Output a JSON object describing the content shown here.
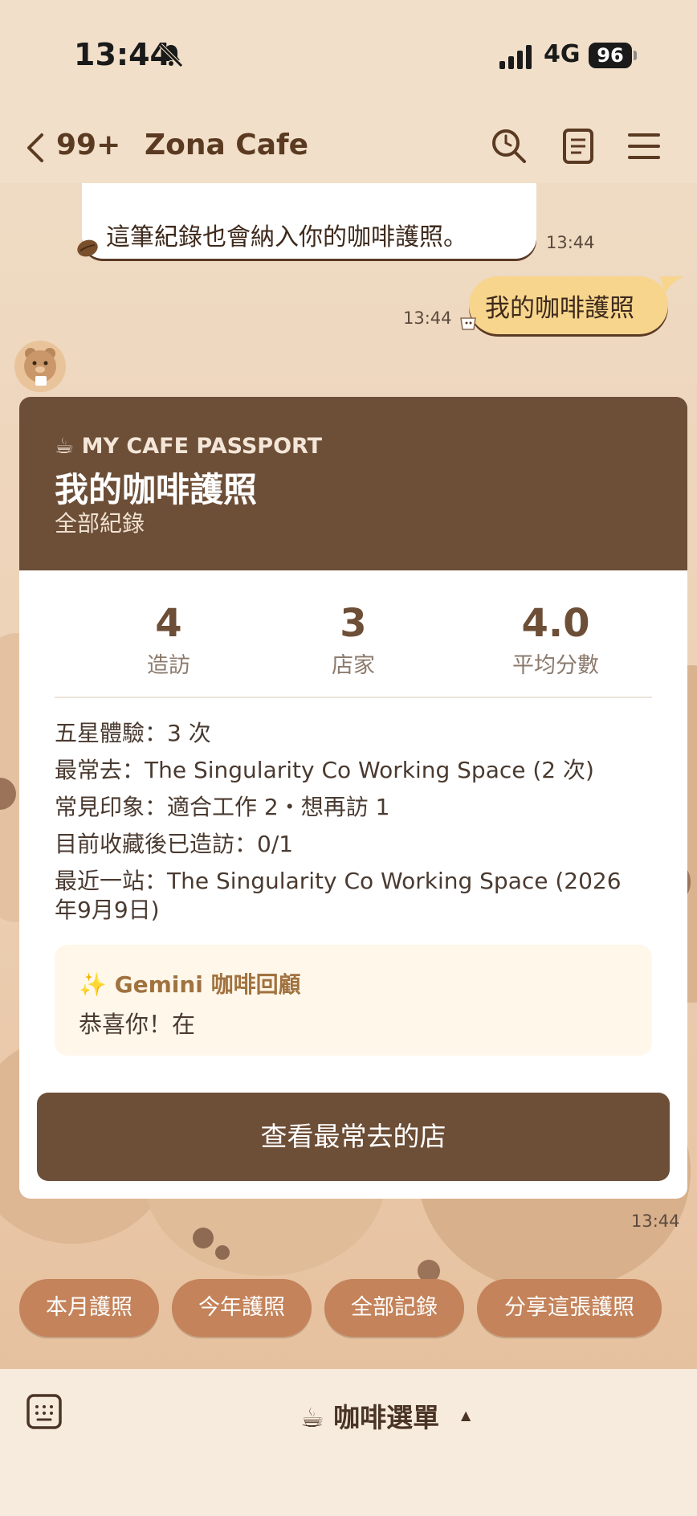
{
  "status_bar": {
    "time": "13:44",
    "network": "4G",
    "battery": "96"
  },
  "header": {
    "unread_count": "99+",
    "title": "Zona Cafe"
  },
  "messages": {
    "incoming_text": "這筆紀錄也會納入你的咖啡護照。",
    "incoming_time": "13:44",
    "outgoing_text": "我的咖啡護照",
    "outgoing_time": "13:44",
    "card_time": "13:44"
  },
  "card": {
    "eyebrow": "☕ MY CAFE PASSPORT",
    "title": "我的咖啡護照",
    "subtitle": "全部紀錄",
    "stats": [
      {
        "value": "4",
        "label": "造訪"
      },
      {
        "value": "3",
        "label": "店家"
      },
      {
        "value": "4.0",
        "label": "平均分數"
      }
    ],
    "details": [
      "五星體驗：3 次",
      "最常去：The Singularity Co Working Space (2 次)",
      "常見印象：適合工作 2・想再訪 1",
      "目前收藏後已造訪：0/1",
      "最近一站：The Singularity Co Working Space (2026",
      "年9月9日)"
    ],
    "gemini_title": "✨ Gemini 咖啡回顧",
    "gemini_body": "恭喜你！在",
    "cta_label": "查看最常去的店"
  },
  "quick_replies": [
    "本月護照",
    "今年護照",
    "全部記錄",
    "分享這張護照"
  ],
  "bottom_bar": {
    "menu_label": "☕ 咖啡選單",
    "caret": "▲"
  },
  "colors": {
    "brand_brown": "#6d4e37",
    "chip": "#c4835a",
    "outgoing_bubble": "#f7d58d",
    "background": "#f1dfca"
  }
}
